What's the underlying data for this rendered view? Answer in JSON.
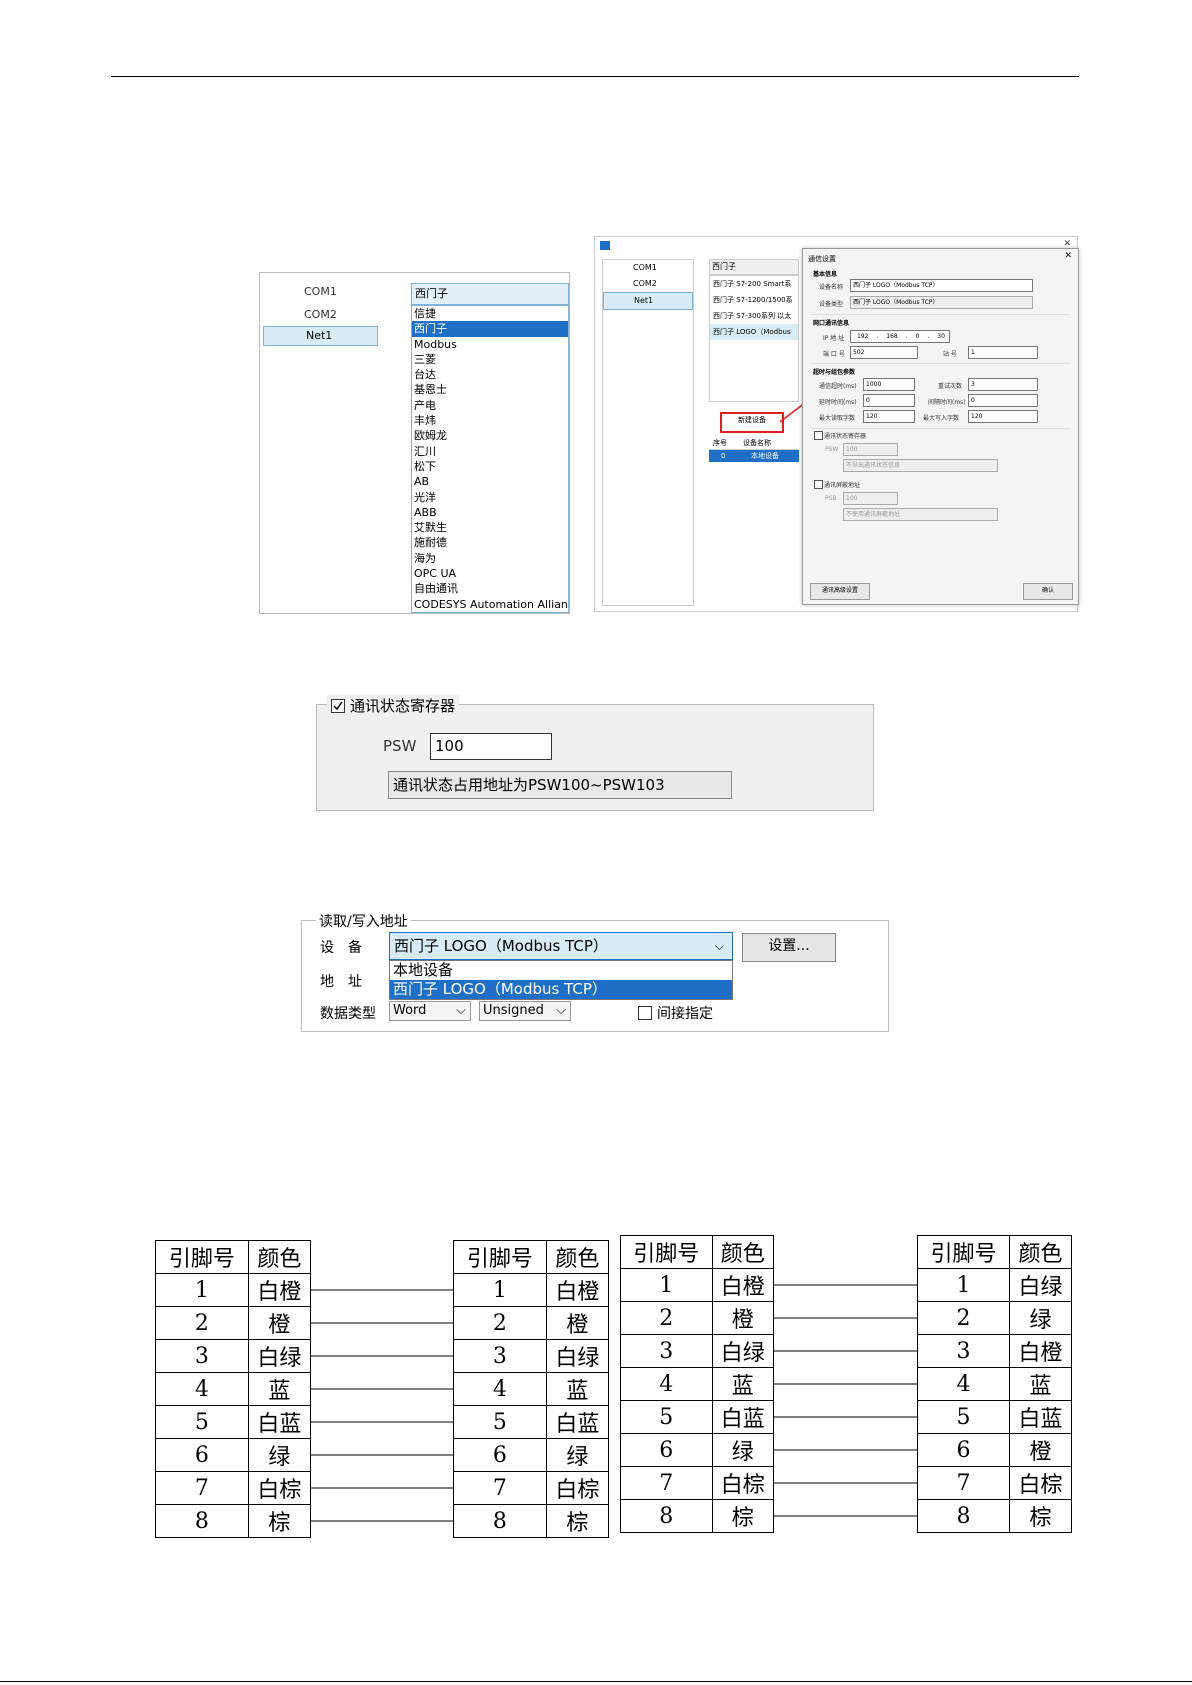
{
  "fig1": {
    "channels": [
      "COM1",
      "COM2",
      "Net1"
    ],
    "combo_value": "西门子",
    "brands": [
      "信捷",
      "西门子",
      "Modbus",
      "三菱",
      "台达",
      "基恩士",
      "产电",
      "丰炜",
      "欧姆龙",
      "汇川",
      "松下",
      "AB",
      "光洋",
      "ABB",
      "艾默生",
      "施耐德",
      "海为",
      "OPC UA",
      "自由通讯",
      "CODESYS Automation Alliance"
    ],
    "selected_brand": "西门子"
  },
  "fig2": {
    "channels": [
      "COM1",
      "COM2",
      "Net1"
    ],
    "brand_header": "西门子",
    "models": [
      "西门子 S7-200 Smart系",
      "西门子 S7-1200/1500系",
      "西门子 S7-300系列 以太",
      "西门子 LOGO（Modbus"
    ],
    "new_device_button": "新建设备",
    "table_headers": [
      "序号",
      "设备名称"
    ],
    "table_row": [
      "0",
      "本地设备"
    ],
    "dialog": {
      "title": "通信设置",
      "basic_section": "基本信息",
      "device_name_label": "设备名称",
      "device_name_value": "西门子 LOGO（Modbus TCP）",
      "device_type_label": "设备类型",
      "device_type_value": "西门子 LOGO（Modbus TCP）",
      "net_section": "网口通讯信息",
      "ip_label": "IP 地 址",
      "ip": [
        "192",
        "168",
        "0",
        "30"
      ],
      "port_label": "端 口 号",
      "port_value": "502",
      "station_label": "站 号",
      "station_value": "1",
      "timeout_section": "超时与组包参数",
      "comm_timeout_label": "通信超时(ms)",
      "comm_timeout_value": "1000",
      "retry_label": "重试次数",
      "retry_value": "3",
      "delay_label": "延时时间(ms)",
      "delay_value": "0",
      "interval_label": "间隔时间(ms)",
      "interval_value": "0",
      "max_read_label": "最大读取字数",
      "max_read_value": "120",
      "max_write_label": "最大写入字数",
      "max_write_value": "120",
      "status_reg_label": "通讯状态寄存器",
      "psw_label": "PSW",
      "psw_value": "100",
      "psw_info": "不导出通讯状态信息",
      "shield_label": "通讯屏蔽地址",
      "psb_label": "PSB",
      "psb_value": "100",
      "psb_info": "不使用通讯屏蔽地址",
      "advanced_button": "通讯高级设置",
      "ok_button": "确认"
    }
  },
  "fig3": {
    "legend": "通讯状态寄存器",
    "psw_label": "PSW",
    "psw_value": "100",
    "info": "通讯状态占用地址为PSW100~PSW103"
  },
  "fig4": {
    "legend": "读取/写入地址",
    "device_label": "设　备",
    "device_value": "西门子 LOGO（Modbus TCP）",
    "settings_button": "设置...",
    "address_label": "地　址",
    "options": [
      "本地设备",
      "西门子 LOGO（Modbus TCP）"
    ],
    "data_type_label": "数据类型",
    "data_type_value": "Word",
    "sign_value": "Unsigned",
    "indirect_label": "间接指定"
  },
  "pin_tables": {
    "headers": [
      "引脚号",
      "颜色"
    ],
    "table1": [
      [
        "1",
        "白橙"
      ],
      [
        "2",
        "橙"
      ],
      [
        "3",
        "白绿"
      ],
      [
        "4",
        "蓝"
      ],
      [
        "5",
        "白蓝"
      ],
      [
        "6",
        "绿"
      ],
      [
        "7",
        "白棕"
      ],
      [
        "8",
        "棕"
      ]
    ],
    "table2": [
      [
        "1",
        "白橙"
      ],
      [
        "2",
        "橙"
      ],
      [
        "3",
        "白绿"
      ],
      [
        "4",
        "蓝"
      ],
      [
        "5",
        "白蓝"
      ],
      [
        "6",
        "绿"
      ],
      [
        "7",
        "白棕"
      ],
      [
        "8",
        "棕"
      ]
    ],
    "table3": [
      [
        "1",
        "白橙"
      ],
      [
        "2",
        "橙"
      ],
      [
        "3",
        "白绿"
      ],
      [
        "4",
        "蓝"
      ],
      [
        "5",
        "白蓝"
      ],
      [
        "6",
        "绿"
      ],
      [
        "7",
        "白棕"
      ],
      [
        "8",
        "棕"
      ]
    ],
    "table4": [
      [
        "1",
        "白绿"
      ],
      [
        "2",
        "绿"
      ],
      [
        "3",
        "白橙"
      ],
      [
        "4",
        "蓝"
      ],
      [
        "5",
        "白蓝"
      ],
      [
        "6",
        "橙"
      ],
      [
        "7",
        "白棕"
      ],
      [
        "8",
        "棕"
      ]
    ]
  }
}
